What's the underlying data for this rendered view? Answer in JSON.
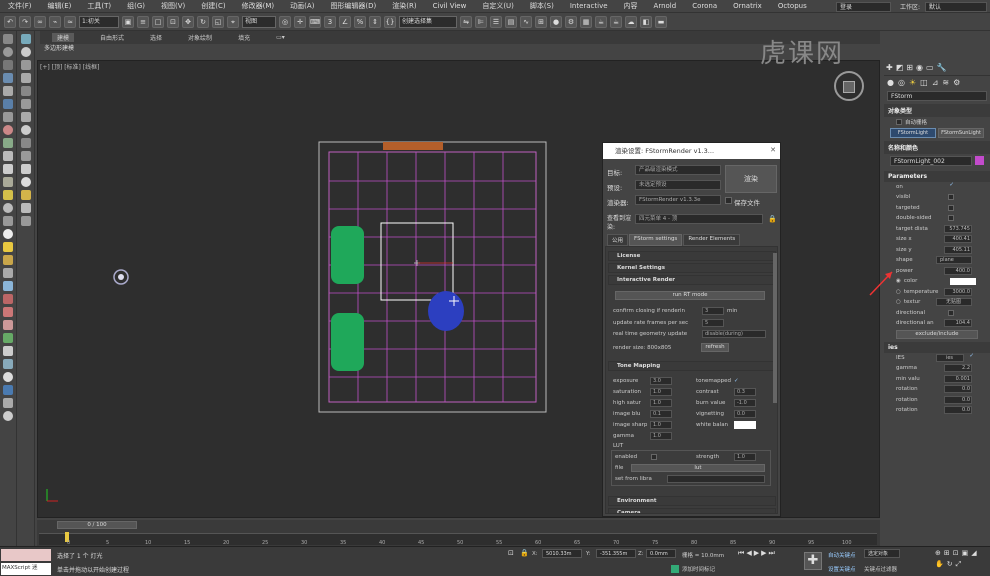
{
  "menu": {
    "items": [
      "文件(F)",
      "编辑(E)",
      "工具(T)",
      "组(G)",
      "视图(V)",
      "创建(C)",
      "修改器(M)",
      "动画(A)",
      "图形编辑器(D)",
      "渲染(R)",
      "Civil View",
      "自定义(U)",
      "脚本(S)",
      "Interactive",
      "内容",
      "Arnold",
      "Corona",
      "Ornatrix",
      "Octopus"
    ],
    "login": "登录",
    "workspace_label": "工作区:",
    "workspace_value": "默认"
  },
  "toolbar": {
    "layer_select": "1:初关",
    "view_select": "视图",
    "selection_set": "创建选择集"
  },
  "ribbon": {
    "tabs": [
      "建模",
      "自由形式",
      "选择",
      "对象绘制",
      "填充"
    ],
    "sub_label": "多边形建模"
  },
  "viewport": {
    "label": "[+] [顶] [标准] [线框]"
  },
  "watermark": "虎课网",
  "dialog": {
    "title": "渲染设置: FStormRender v1.3...",
    "target_label": "目标:",
    "target_value": "产品级渲染模式",
    "preset_label": "预设:",
    "preset_value": "未选定预设",
    "renderer_label": "渲染器:",
    "renderer_value": "FStormRender v1.3.3e",
    "save_file": "保存文件",
    "render_button": "渲染",
    "view_label": "查看到渲染:",
    "view_value": "四元菜单 4 - 顶",
    "tabs": [
      "公用",
      "FStorm settings",
      "Render Elements"
    ],
    "rollouts": {
      "license": "License",
      "kernel": "Kernel Settings",
      "interactive": "Interactive Render",
      "tonemap": "Tone Mapping",
      "environment": "Environment",
      "camera": "Camera"
    },
    "interactive": {
      "run_button": "run RT mode",
      "confirm_label": "confirm closing if renderin",
      "confirm_value": "3",
      "confirm_unit": "min",
      "update_label": "update rate frames per sec",
      "update_value": "5",
      "realtime_label": "real time geometry update",
      "realtime_value": "disable(during)",
      "render_size": "render size: 800x805",
      "refresh_button": "refresh"
    },
    "tonemap": {
      "left": [
        {
          "label": "exposure",
          "value": "3.0"
        },
        {
          "label": "saturation",
          "value": "1.0"
        },
        {
          "label": "high satur",
          "value": "1.0"
        },
        {
          "label": "image blu",
          "value": "0.1"
        },
        {
          "label": "image sharp",
          "value": "1.0"
        },
        {
          "label": "gamma",
          "value": "1.0"
        }
      ],
      "right": [
        {
          "label": "tonemapped",
          "value": "✓"
        },
        {
          "label": "contrast",
          "value": "0.3"
        },
        {
          "label": "burn value",
          "value": "-1.0"
        },
        {
          "label": "vignetting",
          "value": "0.0"
        },
        {
          "label": "white balan",
          "value": ""
        }
      ],
      "lut_label": "LUT",
      "enabled_label": "enabled",
      "strength_label": "strength",
      "strength_value": "1.0",
      "file_label": "file",
      "file_value": "lut",
      "set_from_label": "set from libra"
    }
  },
  "cmdpanel": {
    "category": "FStorm",
    "object_type_header": "对象类型",
    "auto_grid": "自动栅格",
    "btn_light": "FStormLight",
    "btn_sun": "FStormSunLight",
    "name_color_header": "名称和颜色",
    "name_value": "FStormLight_002",
    "light_color": "#c34bcc",
    "parameters_header": "Parameters",
    "params": [
      {
        "label": "on",
        "value": "✓"
      },
      {
        "label": "visibl",
        "value": ""
      },
      {
        "label": "targeted",
        "value": ""
      },
      {
        "label": "double-sided",
        "value": ""
      },
      {
        "label": "target dista",
        "value": "573.745"
      },
      {
        "label": "size x",
        "value": "400.41"
      },
      {
        "label": "size y",
        "value": "405.11"
      },
      {
        "label": "shape",
        "value": "plane"
      },
      {
        "label": "power",
        "value": "400.0"
      },
      {
        "label": "color",
        "value": ""
      },
      {
        "label": "temperature",
        "value": "3000.0"
      },
      {
        "label": "textur",
        "value": "无贴图"
      },
      {
        "label": "directional",
        "value": ""
      },
      {
        "label": "directional an",
        "value": "104.4"
      }
    ],
    "exclude_button": "exclude/include",
    "ies_header": "ies",
    "ies_label": "IES",
    "ies_value": "ies",
    "ies_params": [
      {
        "label": "gamma",
        "value": "2.2"
      },
      {
        "label": "min valu",
        "value": "0.001"
      },
      {
        "label": "rotation",
        "value": "0.0"
      },
      {
        "label": "rotation",
        "value": "0.0"
      },
      {
        "label": "rotation",
        "value": "0.0"
      }
    ]
  },
  "timeline": {
    "frame": "0 / 100",
    "ticks": [
      "0",
      "5",
      "10",
      "15",
      "20",
      "25",
      "30",
      "35",
      "40",
      "45",
      "50",
      "55",
      "60",
      "65",
      "70",
      "75",
      "80",
      "85",
      "90",
      "95",
      "100"
    ]
  },
  "status": {
    "maxscript": "MAXScript 迷",
    "selected": "选择了 1 个 灯光",
    "hint": "单击并拖动以开始创建过程",
    "x": "5010.33m",
    "y": "-351.355m",
    "z": "0.0mm",
    "grid": "栅格 = 10.0mm",
    "auto_key": "自动关键点",
    "select_obj": "选定对象",
    "set_key": "设置关键点",
    "filter": "关键点过滤器",
    "add_time_tag": "添加时间标记"
  }
}
